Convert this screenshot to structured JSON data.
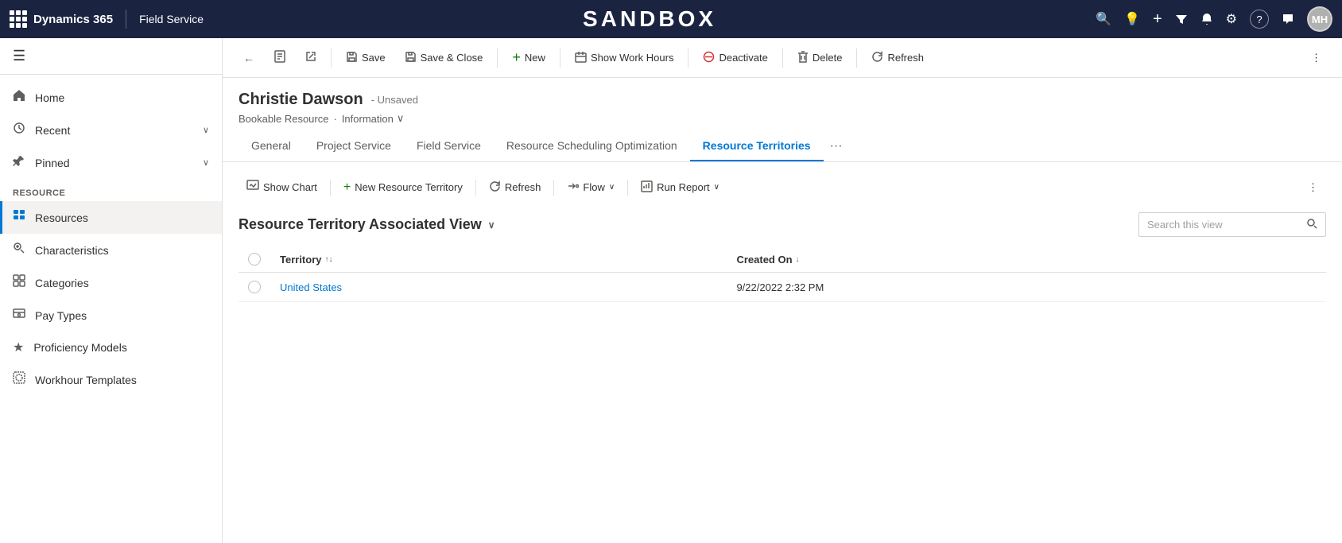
{
  "topNav": {
    "appName": "Dynamics 365",
    "module": "Field Service",
    "sandboxTitle": "SANDBOX",
    "userInitials": "MH",
    "icons": {
      "search": "🔍",
      "lightbulb": "💡",
      "plus": "+",
      "filter": "⚗",
      "bell": "🔔",
      "settings": "⚙",
      "help": "?",
      "chat": "💬"
    }
  },
  "sidebar": {
    "hamburgerLabel": "≡",
    "navItems": [
      {
        "id": "home",
        "label": "Home",
        "icon": "⌂",
        "hasChevron": false,
        "active": false
      },
      {
        "id": "recent",
        "label": "Recent",
        "icon": "⏱",
        "hasChevron": true,
        "active": false
      },
      {
        "id": "pinned",
        "label": "Pinned",
        "icon": "📌",
        "hasChevron": true,
        "active": false
      }
    ],
    "sectionLabel": "Resource",
    "resourceItems": [
      {
        "id": "resources",
        "label": "Resources",
        "icon": "👤",
        "active": true
      },
      {
        "id": "characteristics",
        "label": "Characteristics",
        "icon": "🏷",
        "active": false
      },
      {
        "id": "categories",
        "label": "Categories",
        "icon": "📋",
        "active": false
      },
      {
        "id": "pay-types",
        "label": "Pay Types",
        "icon": "💲",
        "active": false
      },
      {
        "id": "proficiency-models",
        "label": "Proficiency Models",
        "icon": "★",
        "active": false
      },
      {
        "id": "workhour-templates",
        "label": "Workhour Templates",
        "icon": "⏰",
        "active": false
      }
    ]
  },
  "toolbar": {
    "backLabel": "←",
    "saveLabel": "Save",
    "saveCloseLabel": "Save & Close",
    "newLabel": "New",
    "showWorkHoursLabel": "Show Work Hours",
    "deactivateLabel": "Deactivate",
    "deleteLabel": "Delete",
    "refreshLabel": "Refresh"
  },
  "record": {
    "name": "Christie Dawson",
    "status": "Unsaved",
    "entityType": "Bookable Resource",
    "view": "Information"
  },
  "tabs": [
    {
      "id": "general",
      "label": "General",
      "active": false
    },
    {
      "id": "project-service",
      "label": "Project Service",
      "active": false
    },
    {
      "id": "field-service",
      "label": "Field Service",
      "active": false
    },
    {
      "id": "rso",
      "label": "Resource Scheduling Optimization",
      "active": false
    },
    {
      "id": "resource-territories",
      "label": "Resource Territories",
      "active": true
    }
  ],
  "subToolbar": {
    "showChartLabel": "Show Chart",
    "newResourceTerritoryLabel": "New Resource Territory",
    "refreshLabel": "Refresh",
    "flowLabel": "Flow",
    "runReportLabel": "Run Report"
  },
  "associatedView": {
    "title": "Resource Territory Associated View",
    "searchPlaceholder": "Search this view",
    "columns": [
      {
        "id": "territory",
        "label": "Territory",
        "sortable": true
      },
      {
        "id": "created-on",
        "label": "Created On",
        "sortable": true
      }
    ],
    "rows": [
      {
        "territory": "United States",
        "territory_link": true,
        "createdOn": "9/22/2022 2:32 PM"
      }
    ]
  }
}
